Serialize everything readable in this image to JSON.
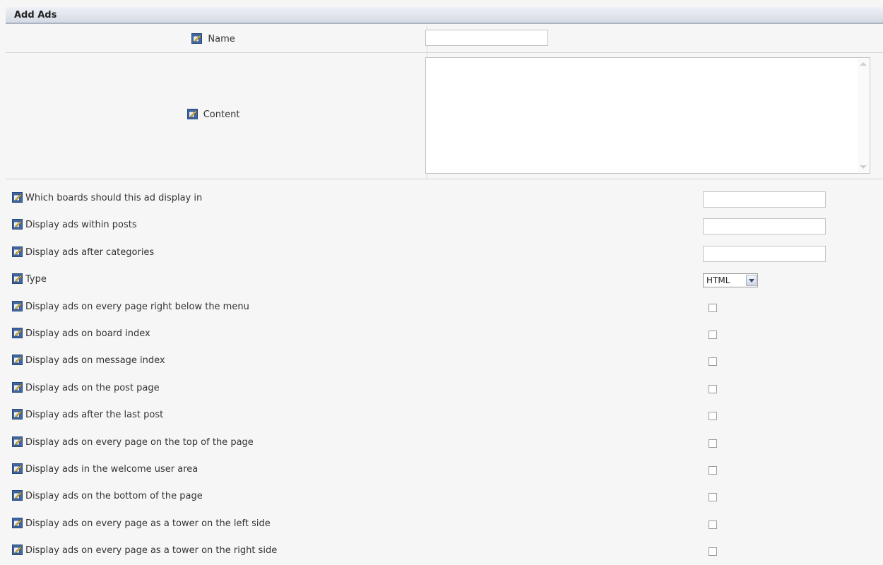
{
  "header": {
    "title": "Add Ads"
  },
  "icon_name": "info-edit-icon",
  "name_field": {
    "label": "Name",
    "value": ""
  },
  "content_field": {
    "label": "Content",
    "value": ""
  },
  "options": [
    {
      "label": "Which boards should this ad display in",
      "control": "text",
      "value": ""
    },
    {
      "label": "Display ads within posts",
      "control": "text",
      "value": ""
    },
    {
      "label": "Display ads after categories",
      "control": "text",
      "value": ""
    },
    {
      "label": "Type",
      "control": "select",
      "value": "HTML"
    },
    {
      "label": "Display ads on every page right below the menu",
      "control": "checkbox",
      "checked": false
    },
    {
      "label": "Display ads on board index",
      "control": "checkbox",
      "checked": false
    },
    {
      "label": "Display ads on message index",
      "control": "checkbox",
      "checked": false
    },
    {
      "label": "Display ads on the post page",
      "control": "checkbox",
      "checked": false
    },
    {
      "label": "Display ads after the last post",
      "control": "checkbox",
      "checked": false
    },
    {
      "label": "Display ads on every page on the top of the page",
      "control": "checkbox",
      "checked": false
    },
    {
      "label": "Display ads in the welcome user area",
      "control": "checkbox",
      "checked": false
    },
    {
      "label": "Display ads on the bottom of the page",
      "control": "checkbox",
      "checked": false
    },
    {
      "label": "Display ads on every page as a tower on the left side",
      "control": "checkbox",
      "checked": false
    },
    {
      "label": "Display ads on every page as a tower on the right side",
      "control": "checkbox",
      "checked": false
    }
  ]
}
